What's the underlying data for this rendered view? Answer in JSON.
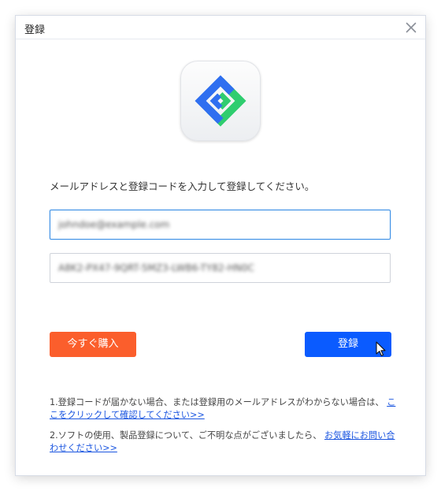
{
  "window": {
    "title": "登録",
    "close_icon": "close-icon"
  },
  "app_icon": "app-logo-icon",
  "instruction": "メールアドレスと登録コードを入力して登録してください。",
  "fields": {
    "email_value": "johndoe@example.com",
    "code_value": "A8K2-PX47-9QRT-5MZ3-LWB6-TY82-HN0C"
  },
  "buttons": {
    "buy_label": "今すぐ購入",
    "register_label": "登録"
  },
  "notes": {
    "note1_text": "1.登録コードが届かない場合、または登録用のメールアドレスがわからない場合は、",
    "note1_link": "ここをクリックして確認してください>>",
    "note2_text": "2.ソフトの使用、製品登録について、ご不明な点がございましたら、",
    "note2_link": "お気軽にお問い合わせください>>"
  },
  "colors": {
    "buy": "#fb5e2c",
    "register": "#0a5bff",
    "link": "#1a55e0",
    "focus_border": "#3a8fe6"
  }
}
